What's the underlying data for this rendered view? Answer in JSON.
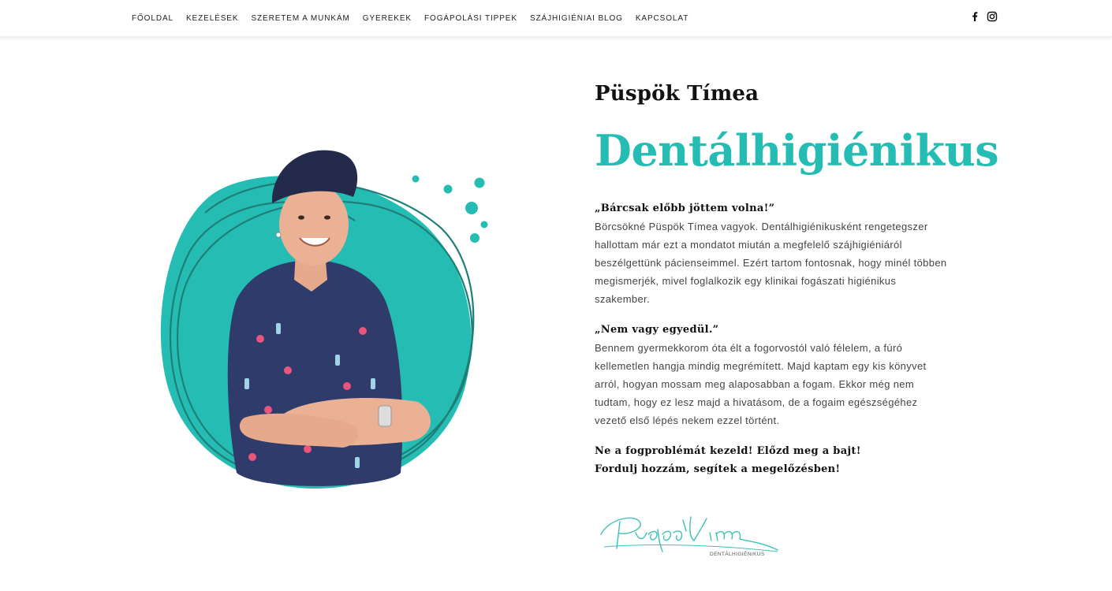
{
  "nav": {
    "items": [
      {
        "label": "FŐOLDAL"
      },
      {
        "label": "KEZELÉSEK"
      },
      {
        "label": "SZERETEM A MUNKÁM"
      },
      {
        "label": "GYEREKEK"
      },
      {
        "label": "FOGÁPOLÁSI TIPPEK"
      },
      {
        "label": "SZÁJHIGIÉNIAI BLOG"
      },
      {
        "label": "KAPCSOLAT"
      }
    ],
    "social": [
      {
        "icon": "facebook-icon"
      },
      {
        "icon": "instagram-icon"
      }
    ]
  },
  "hero": {
    "name": "Püspök Tímea",
    "role": "Dentálhigiénikus",
    "quote1": "„Bárcsak előbb jöttem volna!”",
    "para1": "Börcsökné Püspök Tímea vagyok. Dentálhigiénikusként rengetegszer hallottam már ezt a mondatot miután a megfelelő szájhigiéniáról beszélgettünk pácienseimmel. Ezért tartom fontosnak, hogy minél többen megismerjék, mivel foglalkozik egy klinikai fogászati higiénikus szakember.",
    "quote2": "„Nem vagy egyedül.”",
    "para2": "Bennem gyermekkorom óta élt a fogorvostól való félelem, a fúró kellemetlen hangja mindig megrémített. Majd kaptam egy kis könyvet arról, hogyan mossam meg alaposabban a fogam. Ekkor még nem tudtam, hogy ez lesz majd a hivatásom, de a fogaim egészségéhez vezető első lépés nekem ezzel történt.",
    "closing1": "Ne a fogproblémát kezeld! Előzd meg a bajt!",
    "closing2": "Fordulj hozzám, segítek a megelőzésben!",
    "signature_caption": "DENTÁLHIGIÉNIKUS"
  },
  "colors": {
    "accent": "#25bdb3",
    "accent_dark": "#1e7f78",
    "text": "#111111"
  }
}
